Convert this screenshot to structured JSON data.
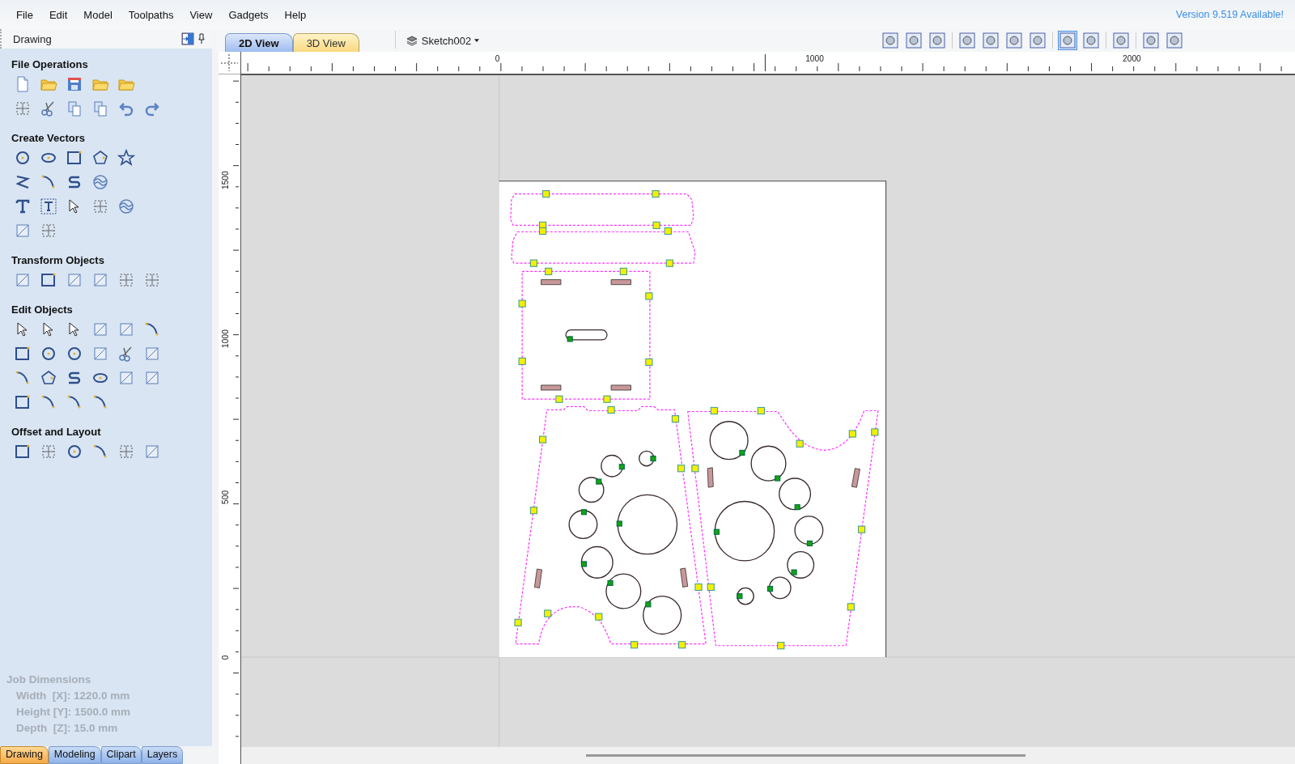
{
  "menu": [
    {
      "label": "File"
    },
    {
      "label": "Edit"
    },
    {
      "label": "Model"
    },
    {
      "label": "Toolpaths"
    },
    {
      "label": "View"
    },
    {
      "label": "Gadgets"
    },
    {
      "label": "Help"
    }
  ],
  "update_notice": "Version 9.519 Available!",
  "panel": {
    "title": "Drawing",
    "sections": [
      {
        "title": "File Operations"
      },
      {
        "title": "Create Vectors"
      },
      {
        "title": "Transform Objects"
      },
      {
        "title": "Edit Objects"
      },
      {
        "title": "Offset and Layout"
      }
    ],
    "job_dimensions": {
      "title": "Job Dimensions",
      "lines": [
        "Width  [X]: 1220.0 mm",
        "Height [Y]: 1500.0 mm",
        "Depth  [Z]: 15.0 mm"
      ]
    },
    "tabs": [
      {
        "label": "Drawing",
        "selected": true
      },
      {
        "label": "Modeling",
        "selected": false
      },
      {
        "label": "Clipart",
        "selected": false
      },
      {
        "label": "Layers",
        "selected": false
      }
    ]
  },
  "view_tabs": [
    {
      "label": "2D View",
      "selected": true
    },
    {
      "label": "3D View",
      "selected": false
    }
  ],
  "sketch_selector": "Sketch002",
  "ruler": {
    "horizontal": [
      "0",
      "1000",
      "2000"
    ],
    "vertical": [
      "1500",
      "1000",
      "500",
      "0"
    ]
  }
}
